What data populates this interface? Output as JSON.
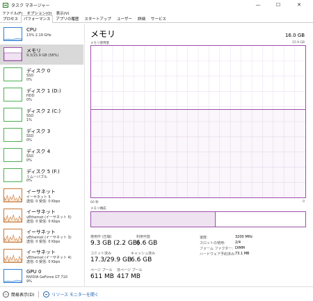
{
  "window": {
    "title": "タスク マネージャー",
    "controls": {
      "minimize": "—",
      "maximize": "☐",
      "close": "✕"
    }
  },
  "menu": [
    "ファイル(F)",
    "オプション(O)",
    "表示(V)"
  ],
  "tabs": [
    {
      "label": "プロセス",
      "active": false
    },
    {
      "label": "パフォーマンス",
      "active": true
    },
    {
      "label": "アプリの履歴",
      "active": false
    },
    {
      "label": "スタートアップ",
      "active": false
    },
    {
      "label": "ユーザー",
      "active": false
    },
    {
      "label": "詳細",
      "active": false
    },
    {
      "label": "サービス",
      "active": false
    }
  ],
  "sidebar": [
    {
      "id": "cpu",
      "title": "CPU",
      "lines": [
        "13%  2.19 GHz"
      ],
      "color": "#2d7dd2",
      "fill": "#dcebf8",
      "selected": false,
      "icon": "cpu-graph-icon"
    },
    {
      "id": "memory",
      "title": "メモリ",
      "lines": [
        "9.3/15.9 GB (58%)"
      ],
      "color": "#9b4fa8",
      "fill": "#efe3f2",
      "selected": true,
      "icon": "memory-graph-icon"
    },
    {
      "id": "disk0",
      "title": "ディスク 0",
      "lines": [
        "SSD",
        "0%"
      ],
      "color": "#4caf50",
      "fill": "#e6f4e6",
      "selected": false,
      "icon": "disk-graph-icon"
    },
    {
      "id": "disk1",
      "title": "ディスク 1 (D:)",
      "lines": [
        "HDD",
        "0%"
      ],
      "color": "#4caf50",
      "fill": "#e6f4e6",
      "selected": false,
      "icon": "disk-graph-icon"
    },
    {
      "id": "disk2",
      "title": "ディスク 2 (C:)",
      "lines": [
        "SSD",
        "1%"
      ],
      "color": "#4caf50",
      "fill": "#e6f4e6",
      "selected": false,
      "icon": "disk-graph-icon"
    },
    {
      "id": "disk3",
      "title": "ディスク 3",
      "lines": [
        "SSD",
        "0%"
      ],
      "color": "#4caf50",
      "fill": "#e6f4e6",
      "selected": false,
      "icon": "disk-graph-icon"
    },
    {
      "id": "disk4",
      "title": "ディスク 4",
      "lines": [
        "SSD",
        "0%"
      ],
      "color": "#4caf50",
      "fill": "#e6f4e6",
      "selected": false,
      "icon": "disk-graph-icon"
    },
    {
      "id": "disk5",
      "title": "ディスク 5 (F:)",
      "lines": [
        "リムーバブル",
        "0%"
      ],
      "color": "#4caf50",
      "fill": "#e6f4e6",
      "selected": false,
      "icon": "disk-graph-icon"
    },
    {
      "id": "eth1",
      "title": "イーサネット",
      "lines": [
        "イーサネット 5",
        "送信: 0 受信: 0 Kbps"
      ],
      "color": "#c87533",
      "fill": "#f8ece0",
      "selected": false,
      "icon": "network-graph-icon"
    },
    {
      "id": "eth2",
      "title": "イーサネット",
      "lines": [
        "vEthernet (イーサネット 5)",
        "送信: 0 受信: 0 Kbps"
      ],
      "color": "#c87533",
      "fill": "#f8ece0",
      "selected": false,
      "icon": "network-graph-icon"
    },
    {
      "id": "eth3",
      "title": "イーサネット",
      "lines": [
        "vEthernet (イーサネット 3)",
        "送信: 0 受信: 0 Kbps"
      ],
      "color": "#c87533",
      "fill": "#f8ece0",
      "selected": false,
      "icon": "network-graph-icon"
    },
    {
      "id": "eth4",
      "title": "イーサネット",
      "lines": [
        "vEthernet (イーサネット 4)",
        "送信: 0 受信: 0 Kbps"
      ],
      "color": "#c87533",
      "fill": "#f8ece0",
      "selected": false,
      "icon": "network-graph-icon"
    },
    {
      "id": "gpu0",
      "title": "GPU 0",
      "lines": [
        "NVIDIA GeForce GT 710",
        "9%"
      ],
      "color": "#2d7dd2",
      "fill": "#dcebf8",
      "selected": false,
      "icon": "gpu-graph-icon"
    }
  ],
  "main": {
    "title": "メモリ",
    "total": "16.0 GB",
    "usage_label": "メモリ使用量",
    "usage_max": "15.9 GB",
    "usage_fraction": 0.58,
    "time_left": "60 秒",
    "time_right": "0",
    "composition_label": "メモリ構成",
    "composition_fraction": 0.58,
    "accent": "#9b4fa8",
    "stats": {
      "in_use_label": "使用中 (圧縮)",
      "in_use_value": "9.3 GB (2.2 GB)",
      "available_label": "利用可能",
      "available_value": "6.6 GB",
      "committed_label": "コミット済み",
      "committed_value": "17.3/29.9 GB",
      "cached_label": "キャッシュ済み",
      "cached_value": "6.6 GB",
      "paged_label": "ページ プール",
      "paged_value": "611 MB",
      "nonpaged_label": "非ページ プール",
      "nonpaged_value": "417 MB"
    },
    "props": [
      {
        "label": "速度:",
        "value": "3200 MHz"
      },
      {
        "label": "スロットの使用:",
        "value": "2/4"
      },
      {
        "label": "フォーム ファクター:",
        "value": "DIMM"
      },
      {
        "label": "ハードウェア予約済み:",
        "value": "73.1 MB"
      }
    ]
  },
  "footer": {
    "fewer_details": "簡易表示(D)",
    "resource_monitor": "リソース モニターを開く"
  }
}
